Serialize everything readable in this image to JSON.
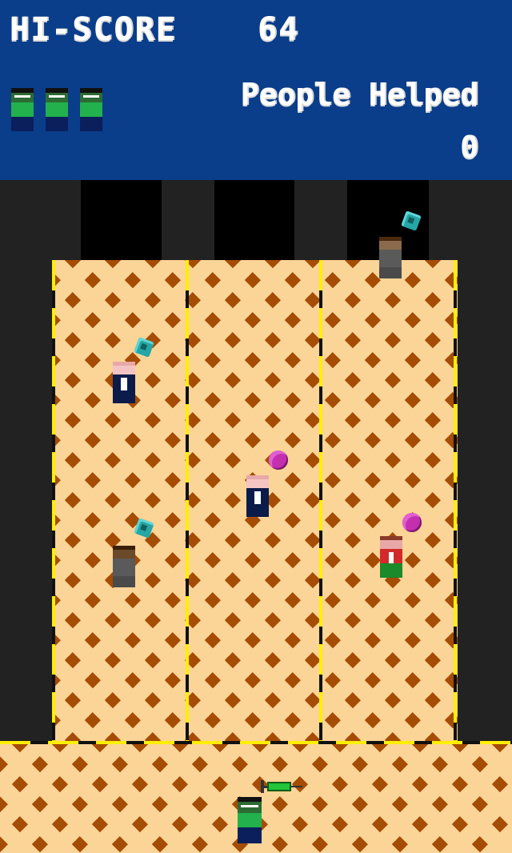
{
  "hud": {
    "hiscore_label": "HI-SCORE",
    "hiscore_value": "64",
    "people_helped_label": "People Helped",
    "people_helped_value": "0",
    "lives_remaining": 3
  },
  "colors": {
    "hud_background": "#0a3d8a",
    "floor_dark": "#a64d05",
    "floor_light": "#fbd497",
    "lane_line": "#ffee00",
    "wall": "#222222",
    "player_shirt": "#22b14c",
    "syringe": "#22c43a"
  },
  "scene": {
    "lanes": 3,
    "entities": [
      {
        "type": "gem",
        "icon": "teal-gem-icon"
      },
      {
        "type": "gem",
        "icon": "teal-gem-icon"
      },
      {
        "type": "gem",
        "icon": "teal-gem-icon"
      },
      {
        "type": "blob",
        "icon": "magenta-germ-icon"
      },
      {
        "type": "blob",
        "icon": "magenta-germ-icon"
      },
      {
        "type": "patient",
        "style": "navy-suit"
      },
      {
        "type": "patient",
        "style": "navy-suit"
      },
      {
        "type": "patient",
        "style": "grey-robe"
      },
      {
        "type": "patient",
        "style": "grey-robe"
      },
      {
        "type": "patient",
        "style": "red-green"
      }
    ],
    "player_item": "syringe-icon"
  }
}
